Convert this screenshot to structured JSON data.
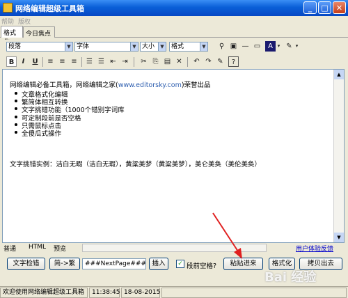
{
  "window": {
    "title": "网络编辑超级工具箱",
    "minimize": "_",
    "maximize": "□",
    "close": "✕"
  },
  "menu": [
    "帮助",
    "版权"
  ],
  "tabs": [
    "格式化",
    "今日焦点"
  ],
  "toolbar": {
    "paragraph": "段落",
    "font": "字体",
    "size": "大小",
    "format": "格式",
    "bold": "B",
    "italic": "I",
    "underline": "U"
  },
  "editor": {
    "line1_prefix": "网络编辑必备工具箱，网络编辑之家(",
    "line1_link": "www.editorsky.com",
    "line1_suffix": ")荣誉出品",
    "features": [
      "文章格式化编辑",
      "繁简体相互转换",
      "文字挑错功能（1000个错别字词库",
      "可定制段前是否空格",
      "只需鼠标点击",
      "全傻瓜式操作"
    ],
    "example": "文字挑错实例：洁白无暇（洁白无瑕），黄粱美梦（黄粱美梦），美仑美奂（美伦美奂）"
  },
  "view_tabs": [
    "普通",
    "HTML",
    "预览"
  ],
  "feedback_link": "用户体验反馈",
  "actions": {
    "check_text": "文字检错",
    "simp_to_trad": "简->繁",
    "nextpage_value": "###NextPage###",
    "insert": "插入",
    "space_label": "段前空格?",
    "space_checked": true,
    "paste_in": "粘贴进来",
    "format": "格式化",
    "copy_out": "拷贝出去"
  },
  "status": {
    "welcome": "欢迎使用网络编辑超级工具箱",
    "time": "11:38:45",
    "date": "18-08-2015"
  },
  "watermark": "Bai 经验",
  "colors": {
    "titlebar": "#0a5fd8",
    "arrow": "#e02020",
    "link": "#0000cc"
  }
}
